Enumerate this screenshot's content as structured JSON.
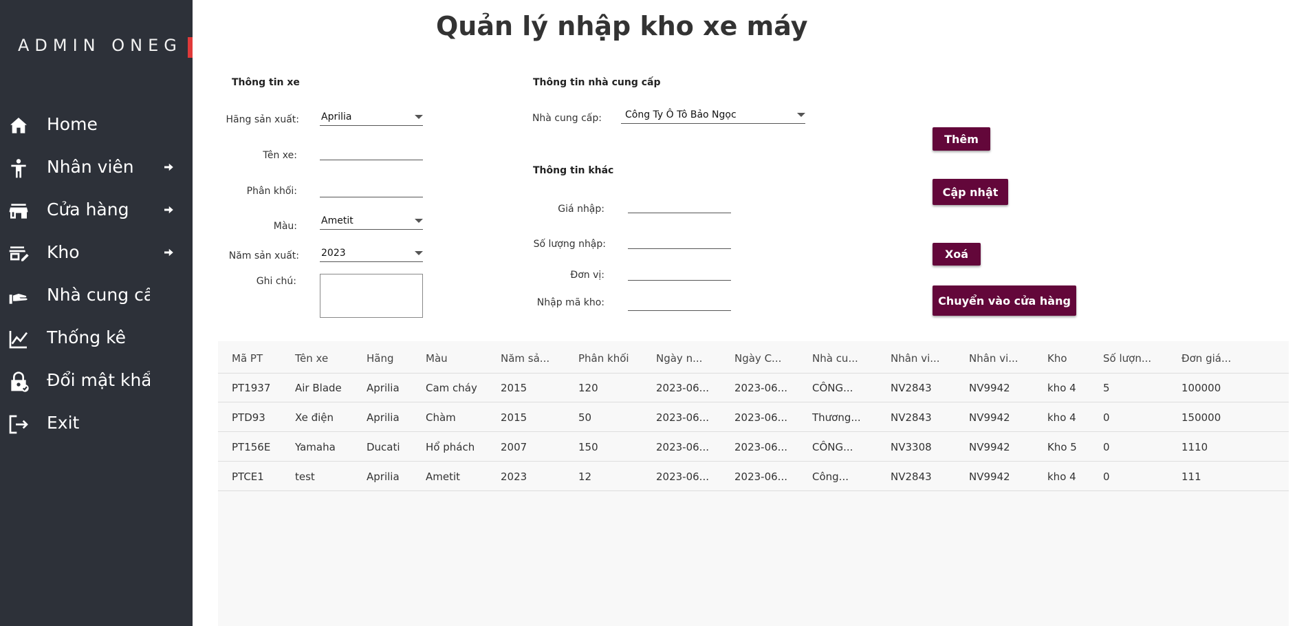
{
  "app": {
    "brand": "ADMIN ONEG"
  },
  "sidebar": {
    "items": [
      {
        "label": "Home",
        "icon": "home-icon",
        "arrow": false
      },
      {
        "label": "Nhân viên",
        "icon": "person-icon",
        "arrow": true
      },
      {
        "label": "Cửa hàng",
        "icon": "store-icon",
        "arrow": true
      },
      {
        "label": "Kho",
        "icon": "warehouse-edit-icon",
        "arrow": true
      },
      {
        "label": "Nhà cung cấp",
        "icon": "hand-icon",
        "arrow": false
      },
      {
        "label": "Thống kê",
        "icon": "chart-icon",
        "arrow": false
      },
      {
        "label": "Đổi mật khẩu",
        "icon": "lock-icon",
        "arrow": false
      },
      {
        "label": "Exit",
        "icon": "exit-icon",
        "arrow": false
      }
    ]
  },
  "page": {
    "title": "Quản lý nhập kho xe máy"
  },
  "vehicle": {
    "section": "Thông tin xe",
    "brand_label": "Hãng sản xuất:",
    "brand_value": "Aprilia",
    "name_label": "Tên xe:",
    "name_value": "",
    "cc_label": "Phân khối:",
    "cc_value": "",
    "color_label": "Màu:",
    "color_value": "Ametit",
    "year_label": "Năm sản xuất:",
    "year_value": "2023",
    "note_label": "Ghi chú:",
    "note_value": ""
  },
  "supplier": {
    "section": "Thông tin nhà cung cấp",
    "label": "Nhà cung cấp:",
    "value": "Công Ty  Ô Tô Bảo Ngọc"
  },
  "other": {
    "section": "Thông tin khác",
    "price_label": "Giá nhập:",
    "qty_label": "Số lượng nhập:",
    "unit_label": "Đơn vị:",
    "warehouse_label": "Nhập mã kho:"
  },
  "actions": {
    "add": "Thêm",
    "update": "Cập nhật",
    "delete": "Xoá",
    "transfer": "Chuyển vào cửa hàng"
  },
  "table": {
    "columns": [
      "Mã PT",
      "Tên xe",
      "Hãng",
      "Màu",
      "Năm sả...",
      "Phân khối",
      "Ngày n...",
      "Ngày C...",
      "Nhà cu...",
      "Nhân vi...",
      "Nhân vi...",
      "Kho",
      "Số lượn...",
      "Đơn giá..."
    ],
    "rows": [
      [
        "PT1937",
        "Air Blade",
        "Aprilia",
        "Cam cháy",
        "2015",
        "120",
        "2023-06...",
        "2023-06...",
        "CÔNG...",
        "NV2843",
        "NV9942",
        "kho 4",
        "5",
        "100000"
      ],
      [
        "PTD93",
        "Xe điện",
        "Aprilia",
        "Chàm",
        "2015",
        "50",
        "2023-06...",
        "2023-06...",
        "Thương...",
        "NV2843",
        "NV9942",
        "kho 4",
        "0",
        "150000"
      ],
      [
        "PT156E",
        "Yamaha",
        "Ducati",
        "Hổ phách",
        "2007",
        "150",
        "2023-06...",
        "2023-06...",
        "CÔNG...",
        "NV3308",
        "NV9942",
        "Kho 5",
        "0",
        "1110"
      ],
      [
        "PTCE1",
        "test",
        "Aprilia",
        "Ametit",
        "2023",
        "12",
        "2023-06...",
        "2023-06...",
        " Công...",
        "NV2843",
        "NV9942",
        "kho 4",
        "0",
        "111"
      ]
    ]
  }
}
